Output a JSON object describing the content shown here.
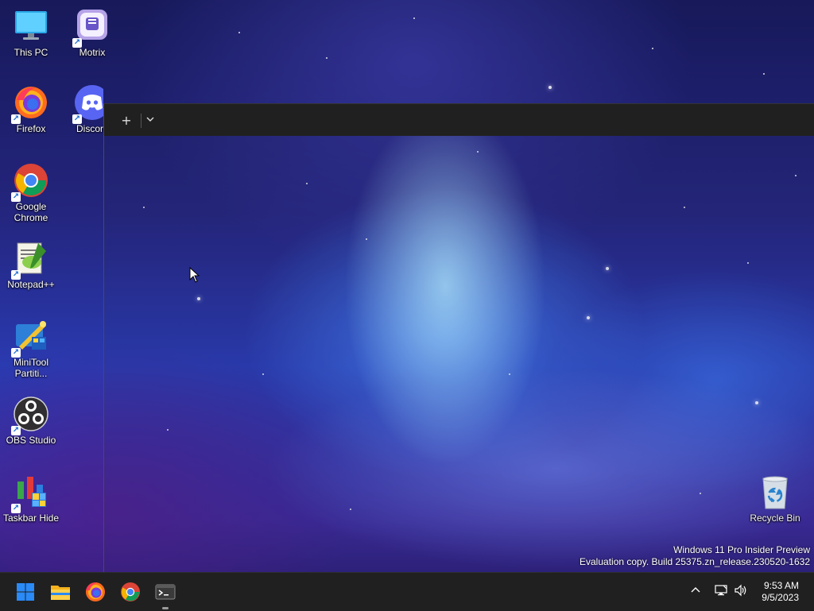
{
  "desktop": {
    "icons": [
      {
        "label": "This PC",
        "icon": "monitor-icon"
      },
      {
        "label": "Motrix",
        "icon": "motrix-icon"
      },
      {
        "label": "Firefox",
        "icon": "firefox-icon"
      },
      {
        "label": "Discord",
        "icon": "discord-icon"
      },
      {
        "label": "Google Chrome",
        "icon": "chrome-icon"
      },
      {
        "label": "Notepad++",
        "icon": "notepadpp-icon"
      },
      {
        "label": "MiniTool Partiti...",
        "icon": "minitool-icon"
      },
      {
        "label": "OBS Studio",
        "icon": "obs-icon"
      },
      {
        "label": "Taskbar Hide",
        "icon": "taskbar-hide-icon"
      },
      {
        "label": "Recycle Bin",
        "icon": "recycle-bin-icon"
      }
    ]
  },
  "terminal": {
    "new_tab_glyph": "+",
    "dropdown_glyph": "⌄"
  },
  "watermark": {
    "line1": "Windows 11 Pro Insider Preview",
    "line2": "Evaluation copy. Build 25375.zn_release.230520-1632"
  },
  "taskbar": {
    "items": [
      "start-icon",
      "file-explorer-icon",
      "firefox-icon",
      "chrome-icon",
      "terminal-icon"
    ],
    "active": "terminal-icon",
    "tray": [
      "chevron-up-icon",
      "network-icon",
      "volume-icon"
    ],
    "time": "9:53 AM",
    "date": "9/5/2023"
  },
  "colors": {
    "taskbar_bg": "#202020",
    "titlebar_bg": "#202020",
    "windows_blue": "#2a8af6"
  }
}
